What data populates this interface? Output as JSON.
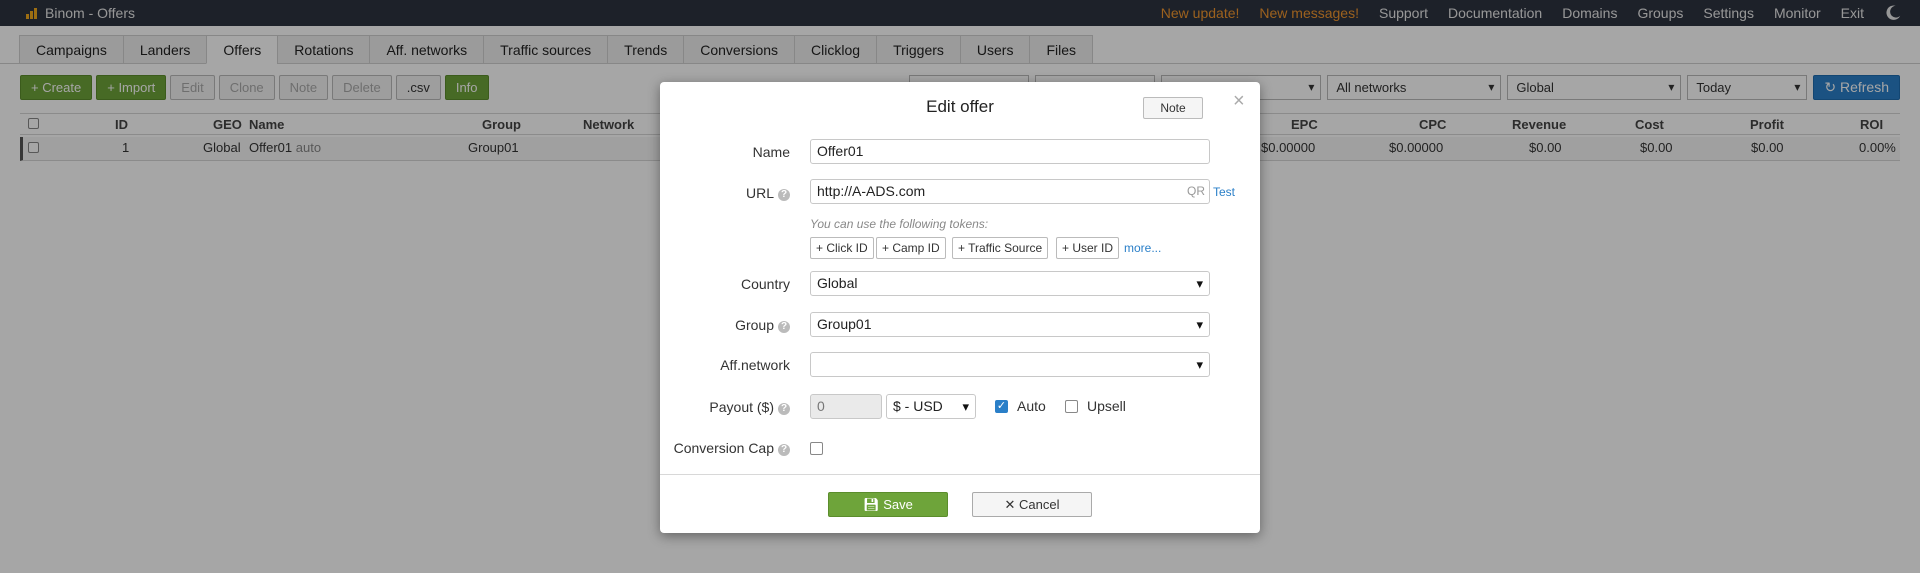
{
  "app": {
    "title": "Binom - Offers"
  },
  "topnav": {
    "new_update": "New update!",
    "new_messages": "New messages!",
    "links": [
      "Support",
      "Documentation",
      "Domains",
      "Groups",
      "Settings",
      "Monitor",
      "Exit"
    ],
    "highlight_color": "#f0962e"
  },
  "tabs": [
    "Campaigns",
    "Landers",
    "Offers",
    "Rotations",
    "Aff. networks",
    "Traffic sources",
    "Trends",
    "Conversions",
    "Clicklog",
    "Triggers",
    "Users",
    "Files"
  ],
  "active_tab": "Offers",
  "toolbar": {
    "create": "+ Create",
    "import": "+ Import",
    "edit": "Edit",
    "clone": "Clone",
    "note": "Note",
    "delete": "Delete",
    "csv": ".csv",
    "info": "Info"
  },
  "filters": {
    "network": "All networks",
    "geo": "Global",
    "date": "Today",
    "refresh": "Refresh"
  },
  "table": {
    "columns": [
      "ID",
      "GEO",
      "Name",
      "Group",
      "Network",
      "EPC",
      "CPC",
      "Revenue",
      "Cost",
      "Profit",
      "ROI"
    ],
    "rows": [
      {
        "id": "1",
        "geo": "Global",
        "name": "Offer01",
        "tag": "auto",
        "group": "Group01",
        "network": "",
        "epc": "$0.00000",
        "cpc": "$0.00000",
        "revenue": "$0.00",
        "cost": "$0.00",
        "profit": "$0.00",
        "roi": "0.00%"
      }
    ]
  },
  "modal": {
    "title": "Edit offer",
    "note_button": "Note",
    "close": "×",
    "labels": {
      "name": "Name",
      "url": "URL",
      "country": "Country",
      "group": "Group",
      "aff_network": "Aff.network",
      "payout": "Payout ($)",
      "conversion_cap": "Conversion Cap"
    },
    "values": {
      "name": "Offer01",
      "url": "http://A-ADS.com",
      "country": "Global",
      "group": "Group01",
      "aff_network": "",
      "payout": "0",
      "currency": "$ - USD"
    },
    "qr": "QR",
    "test": "Test",
    "tokens_hint": "You can use the following tokens:",
    "tokens": [
      "+ Click ID",
      "+ Camp ID",
      "+ Traffic Source",
      "+ User ID"
    ],
    "more": "more...",
    "auto_label": "Auto",
    "auto_checked": true,
    "upsell_label": "Upsell",
    "upsell_checked": false,
    "save": "Save",
    "cancel": "Cancel"
  }
}
